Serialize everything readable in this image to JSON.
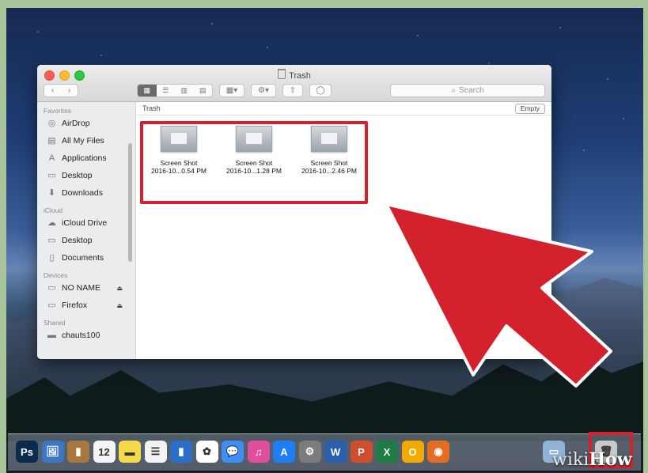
{
  "window": {
    "title": "Trash",
    "nav": {
      "back": "‹",
      "forward": "›"
    },
    "search_placeholder": "Search",
    "path_label": "Trash",
    "empty_button": "Empty"
  },
  "sidebar": {
    "favorites_header": "Favorites",
    "favorites": [
      {
        "label": "AirDrop",
        "icon": "airdrop-icon",
        "glyph": "◎"
      },
      {
        "label": "All My Files",
        "icon": "all-files-icon",
        "glyph": "▤"
      },
      {
        "label": "Applications",
        "icon": "applications-icon",
        "glyph": "A"
      },
      {
        "label": "Desktop",
        "icon": "desktop-icon",
        "glyph": "▭"
      },
      {
        "label": "Downloads",
        "icon": "downloads-icon",
        "glyph": "⬇"
      }
    ],
    "icloud_header": "iCloud",
    "icloud": [
      {
        "label": "iCloud Drive",
        "icon": "cloud-icon",
        "glyph": "☁"
      },
      {
        "label": "Desktop",
        "icon": "desktop-icon",
        "glyph": "▭"
      },
      {
        "label": "Documents",
        "icon": "documents-icon",
        "glyph": "▯"
      }
    ],
    "devices_header": "Devices",
    "devices": [
      {
        "label": "NO NAME",
        "icon": "drive-icon",
        "glyph": "▭",
        "eject": "⏏"
      },
      {
        "label": "Firefox",
        "icon": "drive-icon",
        "glyph": "▭",
        "eject": "⏏"
      }
    ],
    "shared_header": "Shared",
    "shared": [
      {
        "label": "chauts100",
        "icon": "computer-icon",
        "glyph": "▬"
      }
    ]
  },
  "files": [
    {
      "name": "Screen Shot",
      "date": "2016-10...0.54 PM"
    },
    {
      "name": "Screen Shot",
      "date": "2016-10...1.28 PM"
    },
    {
      "name": "Screen Shot",
      "date": "2016-10...2.46 PM"
    }
  ],
  "dock": [
    {
      "icon": "photoshop-icon",
      "glyph": "Ps",
      "color": "#0a2b4d"
    },
    {
      "icon": "preview-icon",
      "glyph": "🖼",
      "color": "#3b77c2"
    },
    {
      "icon": "contacts-icon",
      "glyph": "▮",
      "color": "#a9773e"
    },
    {
      "icon": "calendar-icon",
      "glyph": "12",
      "color": "#f4f4f4"
    },
    {
      "icon": "notes-icon",
      "glyph": "▬",
      "color": "#f5d94b"
    },
    {
      "icon": "reminders-icon",
      "glyph": "☰",
      "color": "#f2f2f2"
    },
    {
      "icon": "book-icon",
      "glyph": "▮",
      "color": "#2b6fc8"
    },
    {
      "icon": "photos-icon",
      "glyph": "✿",
      "color": "#ffffff"
    },
    {
      "icon": "messages-icon",
      "glyph": "💬",
      "color": "#3d8ff5"
    },
    {
      "icon": "itunes-icon",
      "glyph": "♫",
      "color": "#e14e9e"
    },
    {
      "icon": "app-store-icon",
      "glyph": "A",
      "color": "#1d7ff3"
    },
    {
      "icon": "system-preferences-icon",
      "glyph": "⚙",
      "color": "#7c7c7c"
    },
    {
      "icon": "word-icon",
      "glyph": "W",
      "color": "#2b5fae"
    },
    {
      "icon": "powerpoint-icon",
      "glyph": "P",
      "color": "#d04e2c"
    },
    {
      "icon": "excel-icon",
      "glyph": "X",
      "color": "#1f7c44"
    },
    {
      "icon": "outlook-icon",
      "glyph": "O",
      "color": "#f2a900"
    },
    {
      "icon": "firefox-icon",
      "glyph": "◉",
      "color": "#e56d21"
    },
    {
      "icon": "folder-icon",
      "glyph": "▭",
      "color": "#8fb3d8"
    },
    {
      "icon": "trash-icon",
      "glyph": "🗑",
      "color": "#c9c9c9"
    }
  ],
  "watermark": {
    "wiki": "wiki",
    "how": "How"
  },
  "colors": {
    "highlight": "#d3212e",
    "arrow": "#d3212e"
  }
}
